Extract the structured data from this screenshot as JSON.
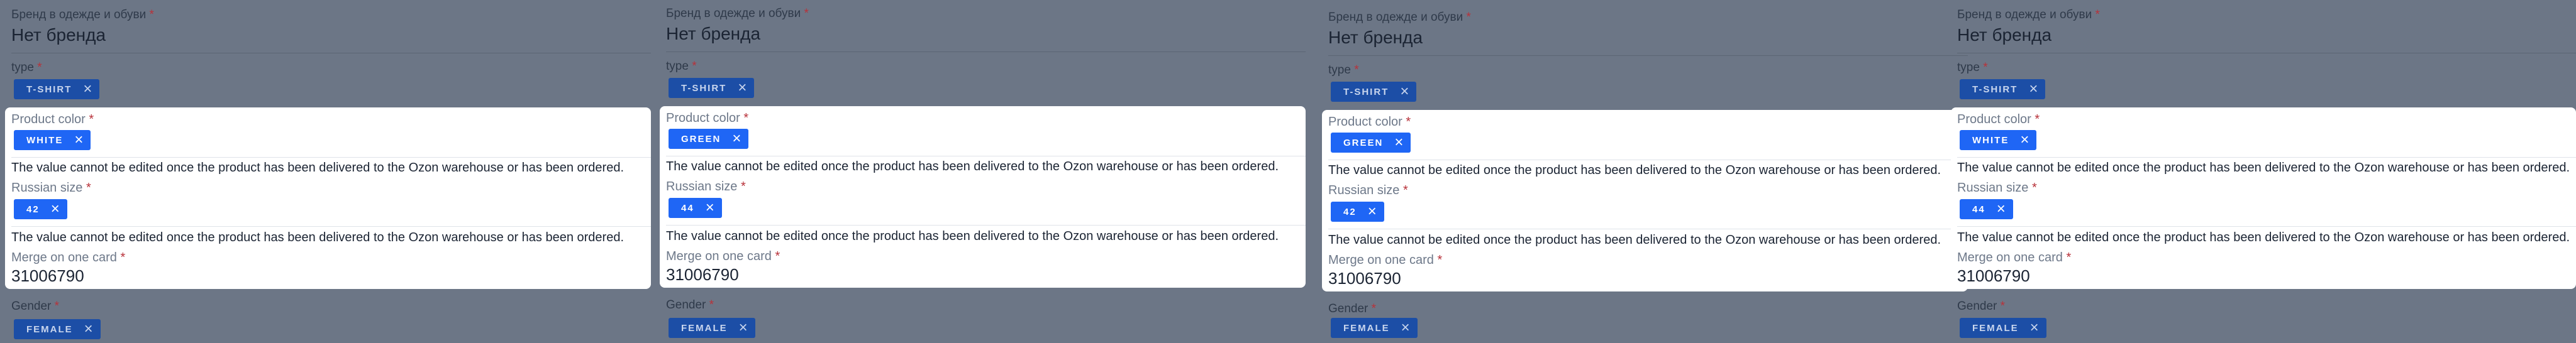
{
  "fields": {
    "brand_label": "Бренд в одежде и обуви",
    "brand_value": "Нет бренда",
    "type_label": "type",
    "color_label": "Product color",
    "size_label": "Russian size",
    "merge_label": "Merge on one card",
    "gender_label": "Gender",
    "required_mark": "*",
    "hint": "The value cannot be edited once the product has been delivered to the Ozon warehouse or has been ordered.",
    "remove_glyph": "×"
  },
  "panels": [
    {
      "type": "T-SHIRT",
      "color": "WHITE",
      "size": "42",
      "merge": "31006790",
      "gender": "FEMALE"
    },
    {
      "type": "T-SHIRT",
      "color": "GREEN",
      "size": "44",
      "merge": "31006790",
      "gender": "FEMALE"
    },
    {
      "type": "T-SHIRT",
      "color": "GREEN",
      "size": "42",
      "merge": "31006790",
      "gender": "FEMALE"
    },
    {
      "type": "T-SHIRT",
      "color": "WHITE",
      "size": "44",
      "merge": "31006790",
      "gender": "FEMALE"
    }
  ],
  "colors": {
    "overlay": "#6c7686",
    "chip_active": "#1f66f5",
    "chip_dimmed": "#1c4ea6",
    "required": "#b8323a"
  }
}
